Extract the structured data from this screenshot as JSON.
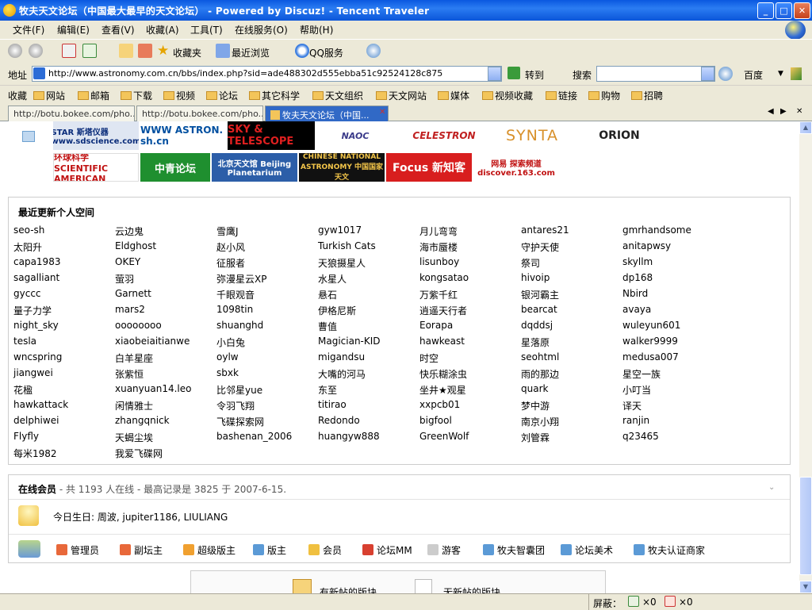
{
  "window": {
    "title": "牧夫天文论坛（中国最大最早的天文论坛） - Powered by Discuz! - Tencent Traveler"
  },
  "menu": [
    "文件(F)",
    "编辑(E)",
    "查看(V)",
    "收藏(A)",
    "工具(T)",
    "在线服务(O)",
    "帮助(H)"
  ],
  "toolbar": {
    "favorites_label": "收藏夹",
    "recent_label": "最近浏览",
    "qq_label": "QQ服务"
  },
  "address": {
    "label": "地址",
    "url": "http://www.astronomy.com.cn/bbs/index.php?sid=ade488302d555ebba51c92524128c875",
    "go_label": "转到",
    "search_label": "搜索",
    "search_value": "",
    "engine": "百度"
  },
  "favbar": {
    "label": "收藏",
    "items": [
      "网站",
      "邮箱",
      "下载",
      "视频",
      "论坛",
      "其它科学",
      "天文组织",
      "天文网站",
      "媒体",
      "视频收藏",
      "链接",
      "购物",
      "招聘"
    ]
  },
  "tabs": [
    {
      "label": "http://botu.bokee.com/pho...",
      "active": false
    },
    {
      "label": "http://botu.bokee.com/pho...",
      "active": false
    },
    {
      "label": "牧夫天文论坛（中国...",
      "active": true
    }
  ],
  "logos": {
    "row1": [
      "STAR 斯塔仪器 www.sdscience.com",
      "WWW ASTRON. sh.cn",
      "SKY & TELESCOPE",
      "NAOC",
      "CELESTRON",
      "SYNTA",
      "ORION"
    ],
    "row2": [
      "环球科学 SCIENTIFIC AMERICAN",
      "中青论坛",
      "北京天文馆 Beijing Planetarium",
      "CHINESE NATIONAL ASTRONOMY 中国国家天文",
      "Focus 新知客",
      "网易 探索频道 discover.163.com"
    ]
  },
  "recent": {
    "title": "最近更新个人空间",
    "rows": [
      [
        "seo-sh",
        "云边鬼",
        "雪鹰J",
        "gyw1017",
        "月儿弯弯",
        "antares21",
        "gmrhandsome"
      ],
      [
        "太阳升",
        "Eldghost",
        "赵小风",
        "Turkish Cats",
        "海市蜃楼",
        "守护天使",
        "anitapwsy"
      ],
      [
        "capa1983",
        "OKEY",
        "征服者",
        "天狼摄星人",
        "lisunboy",
        "祭司",
        "skyllm"
      ],
      [
        "sagalliant",
        "萤羽",
        "弥漫星云XP",
        "水星人",
        "kongsatao",
        "hivoip",
        "dp168"
      ],
      [
        "gyccc",
        "Garnett",
        "千眼观音",
        "悬石",
        "万紫千红",
        "银河霸主",
        "Nbird"
      ],
      [
        "量子力学",
        "mars2",
        "1098tin",
        "伊格尼斯",
        "逍遥天行者",
        "bearcat",
        "avaya"
      ],
      [
        "night_sky",
        "oooooooo",
        "shuanghd",
        "曹值",
        "Eorapa",
        "dqddsj",
        "wuleyun601"
      ],
      [
        "tesla",
        "xiaobeiaitianwe",
        "小白兔",
        "Magician-KID",
        "hawkeast",
        "星落原",
        "walker9999"
      ],
      [
        "wncspring",
        "白羊星座",
        "oylw",
        "migandsu",
        "时空",
        "seohtml",
        "medusa007"
      ],
      [
        "jiangwei",
        "张紫恒",
        "sbxk",
        "大嘴的河马",
        "快乐糊涂虫",
        "雨的那边",
        "星空一族"
      ],
      [
        "花楹",
        "xuanyuan14.leo",
        "比邻星yue",
        "东至",
        "坐井★观星",
        "quark",
        "小叮当"
      ],
      [
        "hawkattack",
        "闲情雅士",
        "令羽飞翔",
        "titirao",
        "xxpcb01",
        "梦中游",
        "译天"
      ],
      [
        "delphiwei",
        "zhangqnick",
        "飞碟探索网",
        "Redondo",
        "bigfool",
        "南京小翔",
        "ranjin"
      ],
      [
        "Flyfly",
        "天蝎尘埃",
        "bashenan_2006",
        "huangyw888",
        "GreenWolf",
        "刘管霖",
        "q23465"
      ],
      [
        "每米1982",
        "我爱飞碟网",
        "",
        "",
        "",
        "",
        ""
      ]
    ]
  },
  "online": {
    "title": "在线会员",
    "summary": "- 共 1193 人在线 - 最高记录是 3825 于 2007-6-15.",
    "birthday": "今日生日: 周波, jupiter1186, LIULIANG",
    "legend": [
      "管理员",
      "副坛主",
      "超级版主",
      "版主",
      "会员",
      "论坛MM",
      "游客",
      "牧夫智囊团",
      "论坛美术",
      "牧夫认证商家"
    ]
  },
  "bottom_panel": [
    "有新帖的版块",
    "无新帖的版块"
  ],
  "status": {
    "label": "屏蔽：",
    "count1": "×0",
    "count2": "×0"
  }
}
